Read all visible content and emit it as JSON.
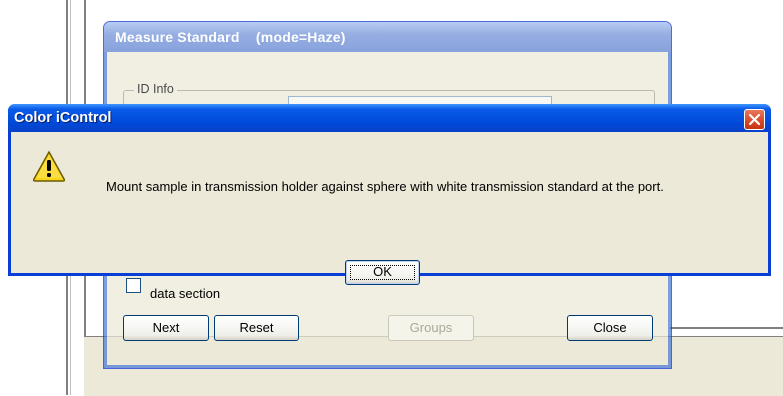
{
  "measure_window": {
    "title": "Measure Standard    (mode=Haze)",
    "id_group_label": "ID Info",
    "data_checkbox_label": "data section",
    "buttons": {
      "next": "Next",
      "reset": "Reset",
      "groups": "Groups",
      "close": "Close"
    }
  },
  "dialog": {
    "title": "Color iControl",
    "message": "Mount sample in transmission holder against sphere with white transmission standard at the port.",
    "ok_label": "OK",
    "icon": "warning-icon",
    "close_icon": "close-icon"
  },
  "colors": {
    "dialog_title_bar": "#0a5be8",
    "close_button": "#d8462a",
    "warning_fill": "#f7d51a"
  }
}
